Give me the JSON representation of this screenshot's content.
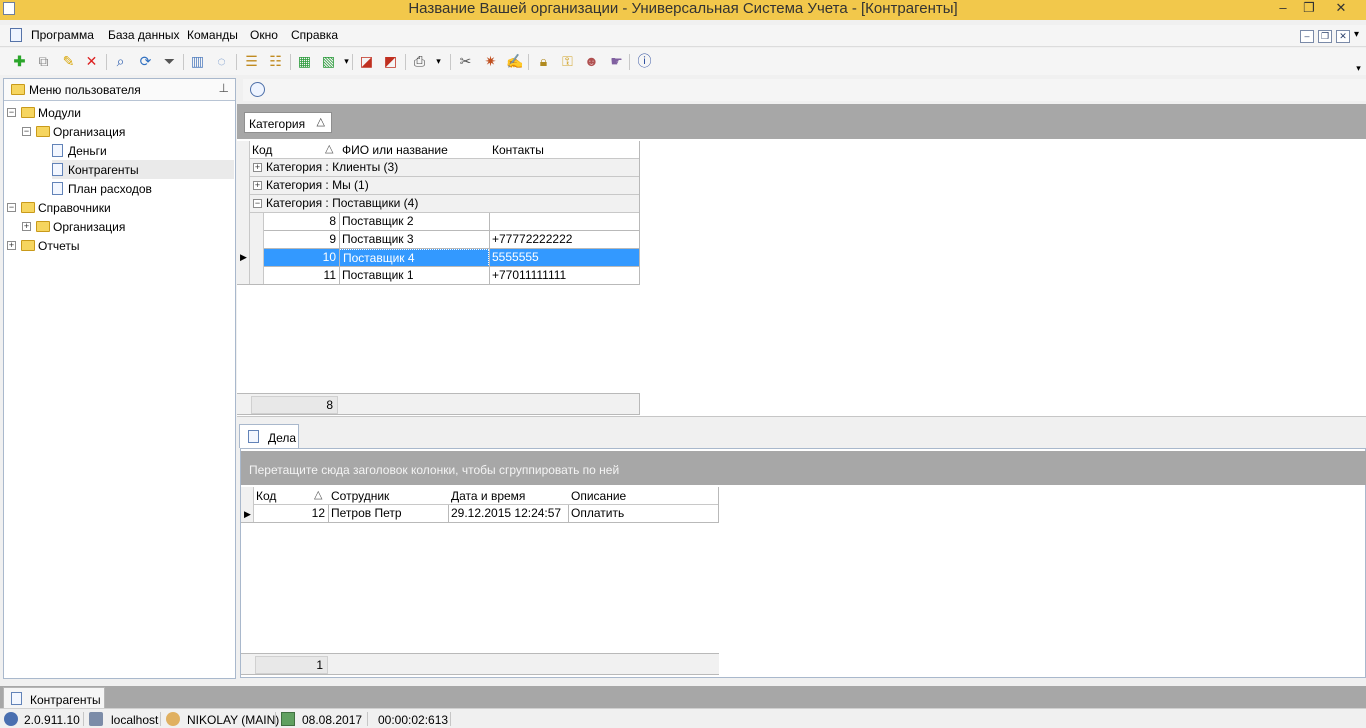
{
  "window": {
    "title": "Название Вашей организации - Универсальная Система Учета - [Контрагенты]"
  },
  "menu": [
    "Программа",
    "База данных",
    "Команды",
    "Окно",
    "Справка"
  ],
  "left_panel": {
    "title": "Меню пользователя",
    "tree": [
      {
        "label": "Модули",
        "kind": "folder",
        "level": 0,
        "expanded": true
      },
      {
        "label": "Организация",
        "kind": "folder",
        "level": 1,
        "expanded": true
      },
      {
        "label": "Деньги",
        "kind": "doc",
        "level": 2
      },
      {
        "label": "Контрагенты",
        "kind": "doc",
        "level": 2,
        "selected": true
      },
      {
        "label": "План расходов",
        "kind": "doc",
        "level": 2
      },
      {
        "label": "Справочники",
        "kind": "folder",
        "level": 0,
        "expanded": true
      },
      {
        "label": "Организация",
        "kind": "folder",
        "level": 1,
        "expanded": false
      },
      {
        "label": "Отчеты",
        "kind": "folder",
        "level": 0,
        "expanded": false
      }
    ]
  },
  "main_grid": {
    "group_chip": "Категория",
    "columns": [
      "Код",
      "ФИО или название",
      "Контакты"
    ],
    "groups": [
      "Категория : Клиенты (3)",
      "Категория : Мы (1)",
      "Категория : Поставщики (4)"
    ],
    "rows": [
      {
        "code": "8",
        "name": "Поставщик 2",
        "contacts": ""
      },
      {
        "code": "9",
        "name": "Поставщик 3",
        "contacts": "+77772222222"
      },
      {
        "code": "10",
        "name": "Поставщик 4",
        "contacts": "5555555",
        "selected": true
      },
      {
        "code": "11",
        "name": "Поставщик 1",
        "contacts": "+77011111111"
      }
    ],
    "footer_count": "8"
  },
  "bottom": {
    "tab_label": "Дела",
    "group_hint": "Перетащите сюда заголовок колонки, чтобы сгруппировать по ней",
    "columns": [
      "Код",
      "Сотрудник",
      "Дата и время",
      "Описание"
    ],
    "rows": [
      {
        "code": "12",
        "employee": "Петров Петр",
        "datetime": "29.12.2015 12:24:57",
        "description": "Оплатить"
      }
    ],
    "footer_count": "1"
  },
  "window_tab": "Контрагенты",
  "status": {
    "version": "2.0.911.10",
    "server": "localhost",
    "user": "NIKOLAY (MAIN)",
    "date": "08.08.2017",
    "elapsed": "00:00:02:613"
  },
  "colors": {
    "titlebar": "#f2c84b",
    "selection": "#3399ff",
    "group_panel": "#a7a7a7"
  }
}
